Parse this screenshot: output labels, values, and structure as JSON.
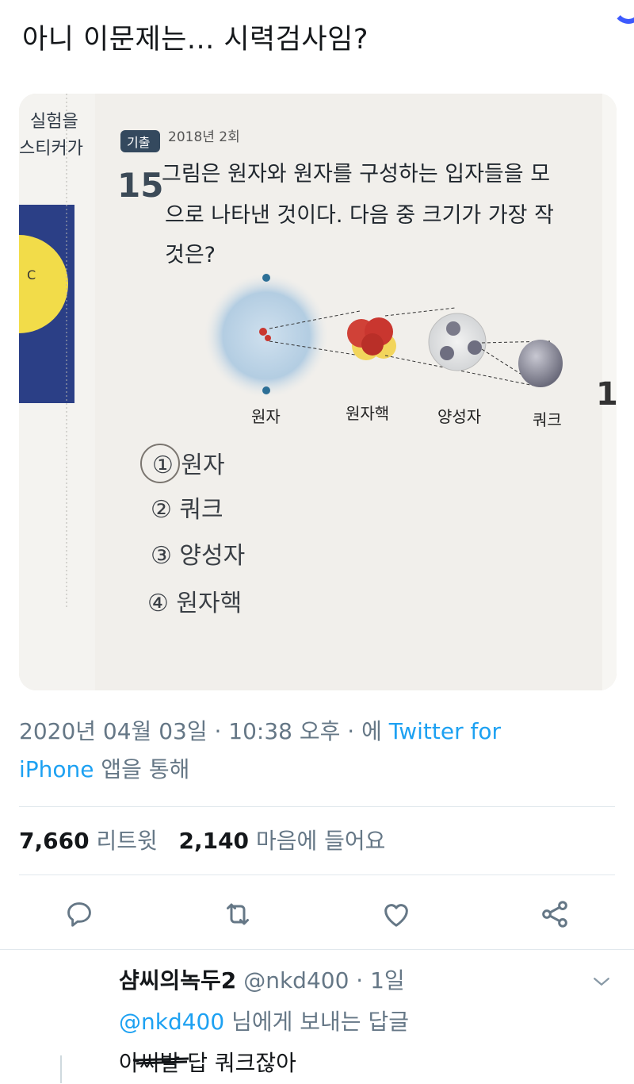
{
  "tweet": {
    "text": "아니 이문제는... 시력검사임?",
    "date": "2020년 04월 03일 · 10:38 오후 · 에",
    "source_a": "Twitter for",
    "source_b": "iPhone",
    "via": "앱을 통해"
  },
  "photo": {
    "side_top": "실험을",
    "side_mid": "스티커가",
    "side_ball": "C",
    "tag": "기출",
    "year": "2018년 2회",
    "qnum": "15",
    "q_line1": "그림은 원자와 원자를 구성하는 입자들을 모",
    "q_line2": "으로 나타낸 것이다. 다음 중 크기가 가장 작",
    "q_line3": "것은?",
    "labels": [
      "원자",
      "원자핵",
      "양성자",
      "쿼크"
    ],
    "choices": [
      "① 원자",
      "② 쿼크",
      "③ 양성자",
      "④ 원자핵"
    ],
    "right_num": "1"
  },
  "stats": {
    "retweets_count": "7,660",
    "retweets_label": "리트윗",
    "likes_count": "2,140",
    "likes_label": "마음에 들어요"
  },
  "actions": [
    "reply-icon",
    "retweet-icon",
    "like-icon",
    "share-icon"
  ],
  "reply": {
    "name": "샴씨의녹두2",
    "handle": "@nkd400 · 1일",
    "to_mention": "@nkd400",
    "to_text": "님에게 보내는 답글",
    "body_scribbled": "아씨발",
    "body_rest": "답 쿼크잖아"
  },
  "colors": {
    "accent": "#1da1f2",
    "muted": "#657786",
    "text": "#14171a"
  }
}
